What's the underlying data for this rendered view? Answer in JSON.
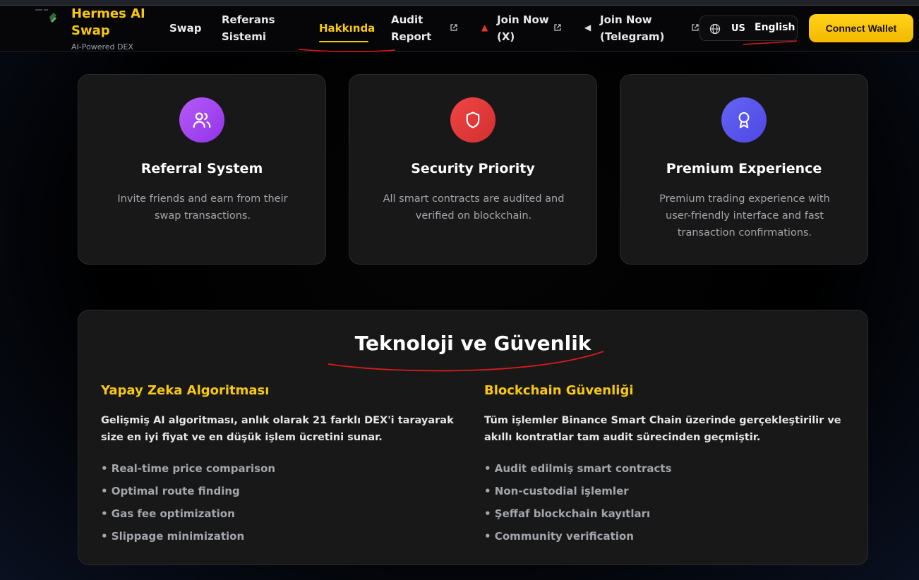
{
  "header": {
    "brand_title": "Hermes AI Swap",
    "brand_subtitle": "AI-Powered DEX",
    "nav": [
      {
        "label": "Swap"
      },
      {
        "label": "Referans Sistemi"
      },
      {
        "label": "Hakkında",
        "active": true
      },
      {
        "label": "Audit Report",
        "external": true
      },
      {
        "label": "Join Now (X)",
        "external": true
      },
      {
        "label": "Join Now (Telegram)",
        "external": true
      }
    ],
    "language": {
      "flag": "US",
      "label": "English"
    },
    "connect_label": "Connect Wallet"
  },
  "features": [
    {
      "title": "Referral System",
      "desc": "Invite friends and earn from their swap transactions.",
      "icon": "users-icon",
      "color": "#a855f7"
    },
    {
      "title": "Security Priority",
      "desc": "All smart contracts are audited and verified on blockchain.",
      "icon": "shield-icon",
      "color": "#e53935"
    },
    {
      "title": "Premium Experience",
      "desc": "Premium trading experience with user-friendly interface and fast transaction confirmations.",
      "icon": "award-icon",
      "color": "#5b5bf0"
    }
  ],
  "tech": {
    "title": "Teknoloji ve Güvenlik",
    "left": {
      "heading": "Yapay Zeka Algoritması",
      "text": "Gelişmiş AI algoritması, anlık olarak 21 farklı DEX'i tarayarak size en iyi fiyat ve en düşük işlem ücretini sunar.",
      "items": [
        "• Real-time price comparison",
        "• Optimal route finding",
        "• Gas fee optimization",
        "• Slippage minimization"
      ]
    },
    "right": {
      "heading": "Blockchain Güvenliği",
      "text": "Tüm işlemler Binance Smart Chain üzerinde gerçekleştirilir ve akıllı kontratlar tam audit sürecinden geçmiştir.",
      "items": [
        "• Audit edilmiş smart contracts",
        "• Non-custodial işlemler",
        "• Şeffaf blockchain kayıtları",
        "• Community verification"
      ]
    }
  },
  "colors": {
    "accent": "#f7c80f",
    "annotation": "#d81b1b"
  }
}
